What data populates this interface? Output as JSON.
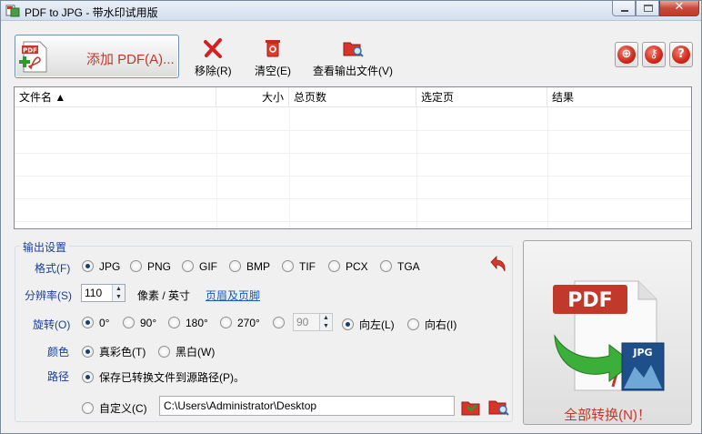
{
  "window": {
    "title": "PDF to JPG - 带水印试用版",
    "controls": {
      "minimize": "–",
      "maximize": "□",
      "close": "✕"
    }
  },
  "toolbar": {
    "add_label": "添加 PDF(A)...",
    "add_icon_text": "PDF",
    "remove_label": "移除(R)",
    "clear_label": "清空(E)",
    "view_output_label": "查看输出文件(V)"
  },
  "right_buttons": [
    {
      "name": "web-icon",
      "glyph": "⊕"
    },
    {
      "name": "key-icon",
      "glyph": "⚷"
    },
    {
      "name": "help-icon",
      "glyph": "?"
    }
  ],
  "file_table": {
    "columns": [
      "文件名 ▲",
      "大小",
      "总页数",
      "选定页",
      "结果"
    ],
    "rows": []
  },
  "output_settings": {
    "group_title": "输出设置",
    "format": {
      "label": "格式(F)",
      "options": [
        "JPG",
        "PNG",
        "GIF",
        "BMP",
        "TIF",
        "PCX",
        "TGA"
      ],
      "selected": "JPG"
    },
    "resolution": {
      "label": "分辨率(S)",
      "value": "110",
      "unit": "像素 / 英寸",
      "header_footer_link": "页眉及页脚"
    },
    "rotation": {
      "label": "旋转(O)",
      "options": [
        "0°",
        "90°",
        "180°",
        "270°"
      ],
      "selected": "0°",
      "custom_value": "90",
      "direction_options": [
        "向左(L)",
        "向右(I)"
      ],
      "direction_selected": "向左(L)"
    },
    "color": {
      "label": "颜色",
      "options": [
        "真彩色(T)",
        "黑白(W)"
      ],
      "selected": "真彩色(T)"
    },
    "path": {
      "label": "路径",
      "options": [
        "保存已转换文件到源路径(P)。",
        "自定义(C)"
      ],
      "selected": "保存已转换文件到源路径(P)。",
      "custom_path": "C:\\Users\\Administrator\\Desktop"
    }
  },
  "convert": {
    "label": "全部转换(N)！",
    "art_pdf_text": "PDF",
    "art_jpg_text": "JPG"
  },
  "colors": {
    "accent_red": "#c0392b",
    "label_blue": "#1a3e96",
    "link_blue": "#1a56c4"
  }
}
